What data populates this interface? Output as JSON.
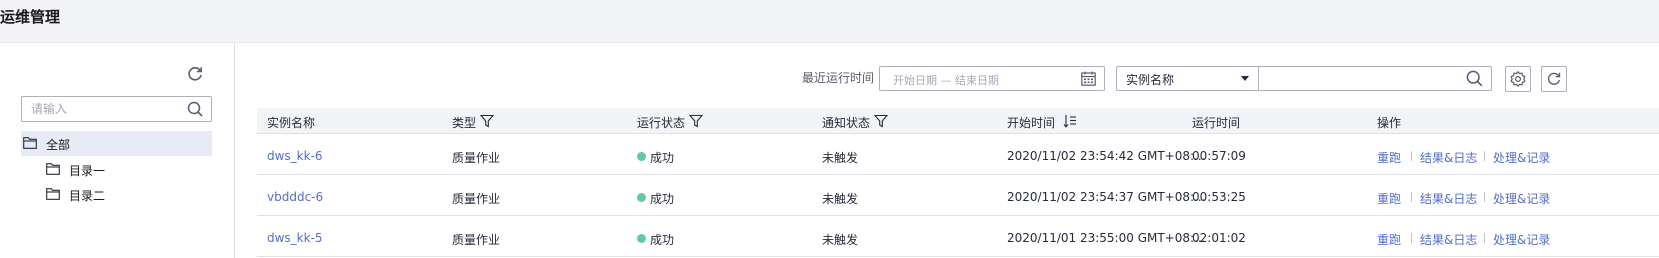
{
  "header": {
    "title": "运维管理"
  },
  "sidebar": {
    "search_placeholder": "请输入",
    "tree": {
      "root_label": "全部",
      "children": [
        {
          "label": "目录一"
        },
        {
          "label": "目录二"
        }
      ]
    }
  },
  "toolbar": {
    "time_filter_label": "最近运行时间",
    "date_range_placeholder": "开始日期 — 结束日期",
    "search_field_select": "实例名称",
    "search_value": ""
  },
  "table": {
    "columns": [
      "实例名称",
      "类型",
      "运行状态",
      "通知状态",
      "开始时间",
      "运行时间",
      "操作"
    ],
    "rows": [
      {
        "name": "dws_kk-6",
        "type": "质量作业",
        "status": "成功",
        "notify": "未触发",
        "start": "2020/11/02 23:54:42 GMT+08:...",
        "duration": "00:57:09"
      },
      {
        "name": "vbdddc-6",
        "type": "质量作业",
        "status": "成功",
        "notify": "未触发",
        "start": "2020/11/02 23:54:37 GMT+08:...",
        "duration": "00:53:25"
      },
      {
        "name": "dws_kk-5",
        "type": "质量作业",
        "status": "成功",
        "notify": "未触发",
        "start": "2020/11/01 23:55:00 GMT+08:...",
        "duration": "02:01:02"
      }
    ],
    "actions": {
      "rerun": "重跑",
      "result_log": "结果&日志",
      "handle_record": "处理&记录"
    }
  },
  "colors": {
    "link": "#526ecc",
    "success": "#5dc9a5",
    "header_bg": "#f3f4f8",
    "tree_selected": "#e6ebf5"
  },
  "icons": [
    "refresh-icon",
    "search-icon",
    "folder-icon",
    "calendar-icon",
    "chevron-down-icon",
    "gear-icon",
    "filter-icon",
    "sort-icon"
  ]
}
